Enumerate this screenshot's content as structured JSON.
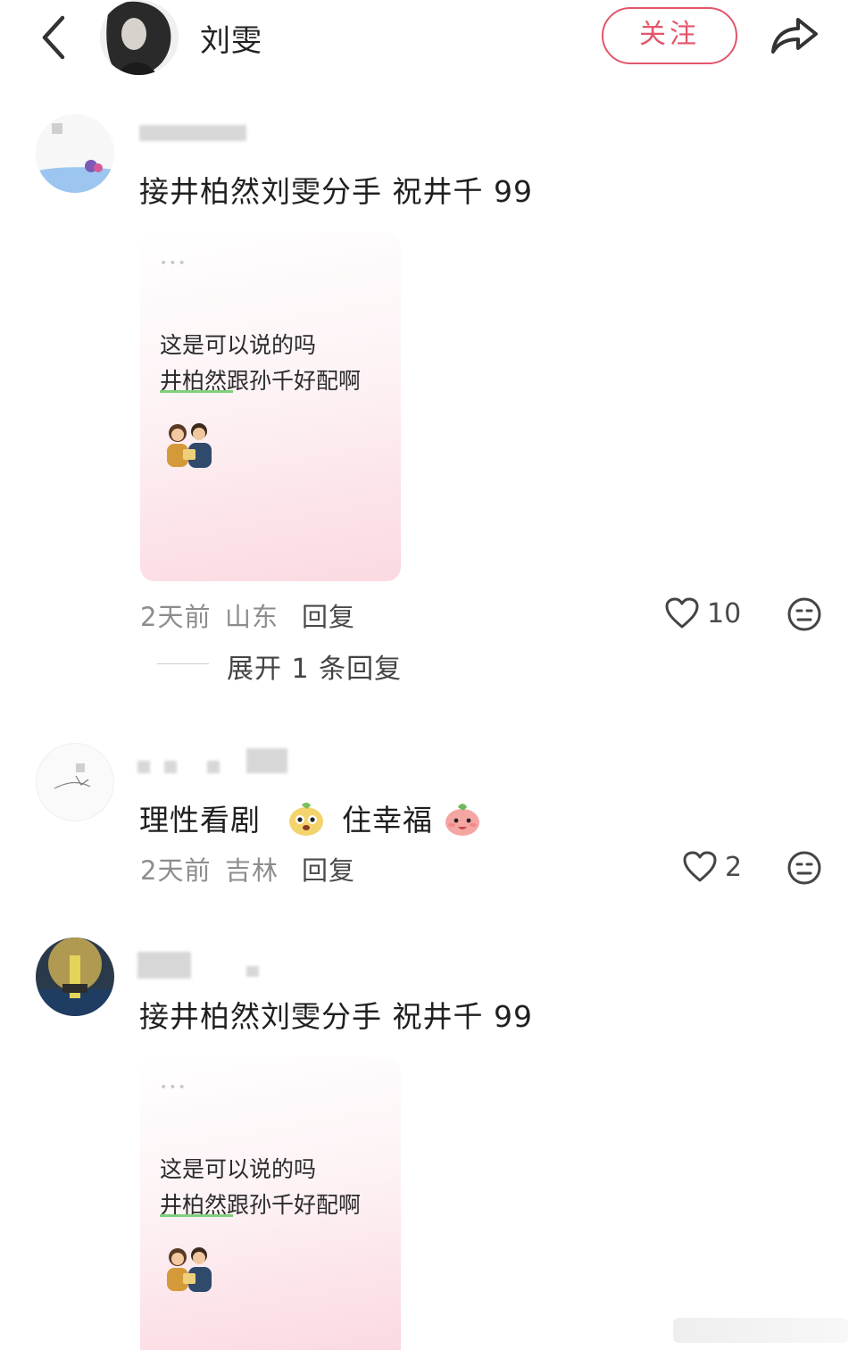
{
  "header": {
    "username": "刘雯",
    "follow_label": "关注"
  },
  "comments": [
    {
      "text": "接井柏然刘雯分手 祝井千 99",
      "image": {
        "line1": "这是可以说的吗",
        "line2": "井柏然跟孙千好配啊"
      },
      "time": "2天前",
      "location": "山东",
      "reply_label": "回复",
      "likes": "10",
      "expand_label": "展开 1 条回复"
    },
    {
      "text_part1": "理性看剧",
      "text_part2": "住幸福",
      "time": "2天前",
      "location": "吉林",
      "reply_label": "回复",
      "likes": "2"
    },
    {
      "text": "接井柏然刘雯分手 祝井千 99",
      "image": {
        "line1": "这是可以说的吗",
        "line2": "井柏然跟孙千好配啊"
      }
    }
  ],
  "icons": {
    "back": "chevron-left-icon",
    "share": "share-arrow-icon",
    "like": "heart-outline-icon",
    "dislike": "meh-face-icon"
  },
  "colors": {
    "accent": "#e2566a",
    "meta_text": "#8d8d8d"
  }
}
